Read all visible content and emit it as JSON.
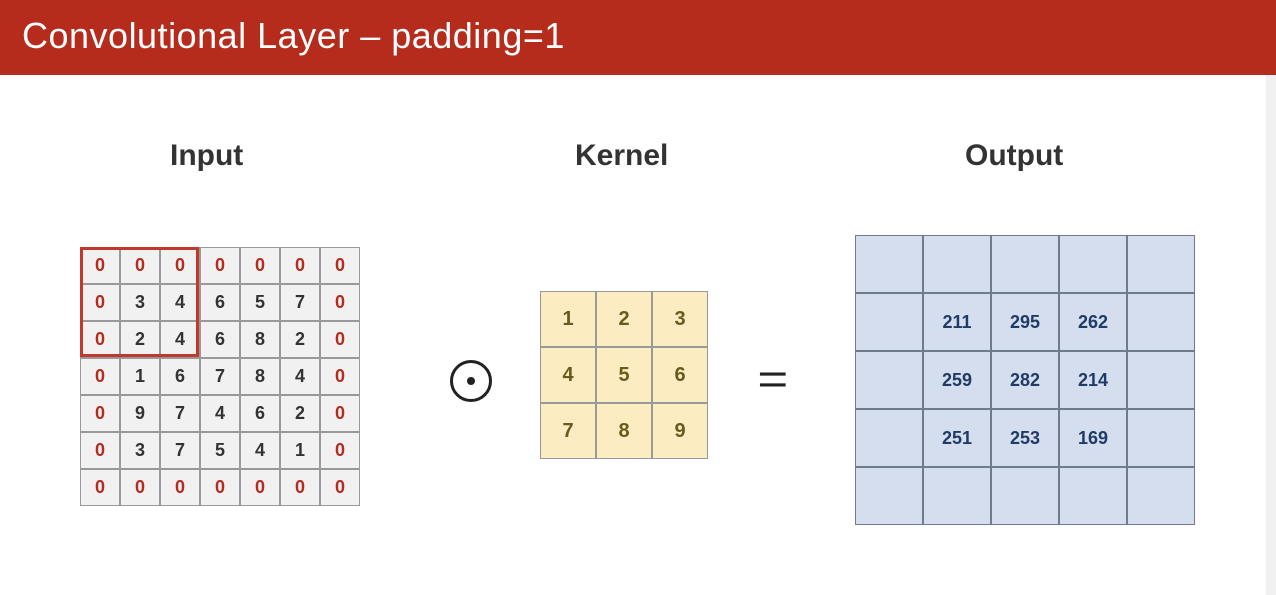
{
  "slide": {
    "title": "Convolutional Layer – padding=1",
    "label_input": "Input",
    "label_kernel": "Kernel",
    "label_output": "Output",
    "op_conv_glyph": "⊙",
    "op_eq_glyph": "="
  },
  "chart_data": {
    "type": "table",
    "description": "2D convolution with zero padding of width 1, showing a 5x5 input padded to 7x7, a 3x3 kernel, and a 5x5 output (center 3x3 values filled).",
    "input_padded": [
      [
        0,
        0,
        0,
        0,
        0,
        0,
        0
      ],
      [
        0,
        3,
        4,
        6,
        5,
        7,
        0
      ],
      [
        0,
        2,
        4,
        6,
        8,
        2,
        0
      ],
      [
        0,
        1,
        6,
        7,
        8,
        4,
        0
      ],
      [
        0,
        9,
        7,
        4,
        6,
        2,
        0
      ],
      [
        0,
        3,
        7,
        5,
        4,
        1,
        0
      ],
      [
        0,
        0,
        0,
        0,
        0,
        0,
        0
      ]
    ],
    "input_is_padding": [
      [
        true,
        true,
        true,
        true,
        true,
        true,
        true
      ],
      [
        true,
        false,
        false,
        false,
        false,
        false,
        true
      ],
      [
        true,
        false,
        false,
        false,
        false,
        false,
        true
      ],
      [
        true,
        false,
        false,
        false,
        false,
        false,
        true
      ],
      [
        true,
        false,
        false,
        false,
        false,
        false,
        true
      ],
      [
        true,
        false,
        false,
        false,
        false,
        false,
        true
      ],
      [
        true,
        true,
        true,
        true,
        true,
        true,
        true
      ]
    ],
    "highlight_window": {
      "row": 0,
      "col": 0,
      "size": 3
    },
    "kernel": [
      [
        1,
        2,
        3
      ],
      [
        4,
        5,
        6
      ],
      [
        7,
        8,
        9
      ]
    ],
    "output": [
      [
        null,
        null,
        null,
        null,
        null
      ],
      [
        null,
        211,
        295,
        262,
        null
      ],
      [
        null,
        259,
        282,
        214,
        null
      ],
      [
        null,
        251,
        253,
        169,
        null
      ],
      [
        null,
        null,
        null,
        null,
        null
      ]
    ]
  }
}
